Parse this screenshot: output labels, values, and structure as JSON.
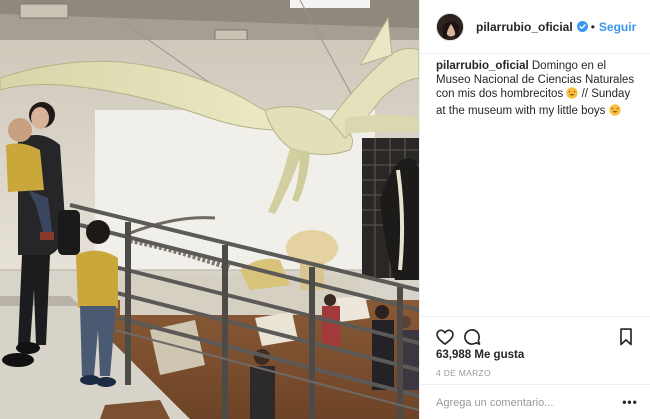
{
  "header": {
    "username": "pilarrubio_oficial",
    "separator": "•",
    "follow_label": "Seguir"
  },
  "caption": {
    "username": "pilarrubio_oficial",
    "text_part1": "Domingo en el Museo Nacional de Ciencias Naturales con mis dos hombrecitos",
    "text_part2": "// Sunday at the museum with my little boys"
  },
  "icons": {
    "avatar": "profile-avatar",
    "verified": "verified-badge-icon",
    "like": "heart-icon",
    "comment": "speech-bubble-icon",
    "save": "bookmark-icon",
    "more": "ellipsis-icon",
    "emoji": "heart-eyes-emoji"
  },
  "stats": {
    "likes": "63,988 Me gusta",
    "date": "4 DE MARZO"
  },
  "comment": {
    "placeholder": "Agrega un comentario...",
    "more_label": "•••"
  },
  "colors": {
    "link_blue": "#3897f0",
    "text": "#262626",
    "muted": "#999999",
    "border": "#efefef"
  }
}
